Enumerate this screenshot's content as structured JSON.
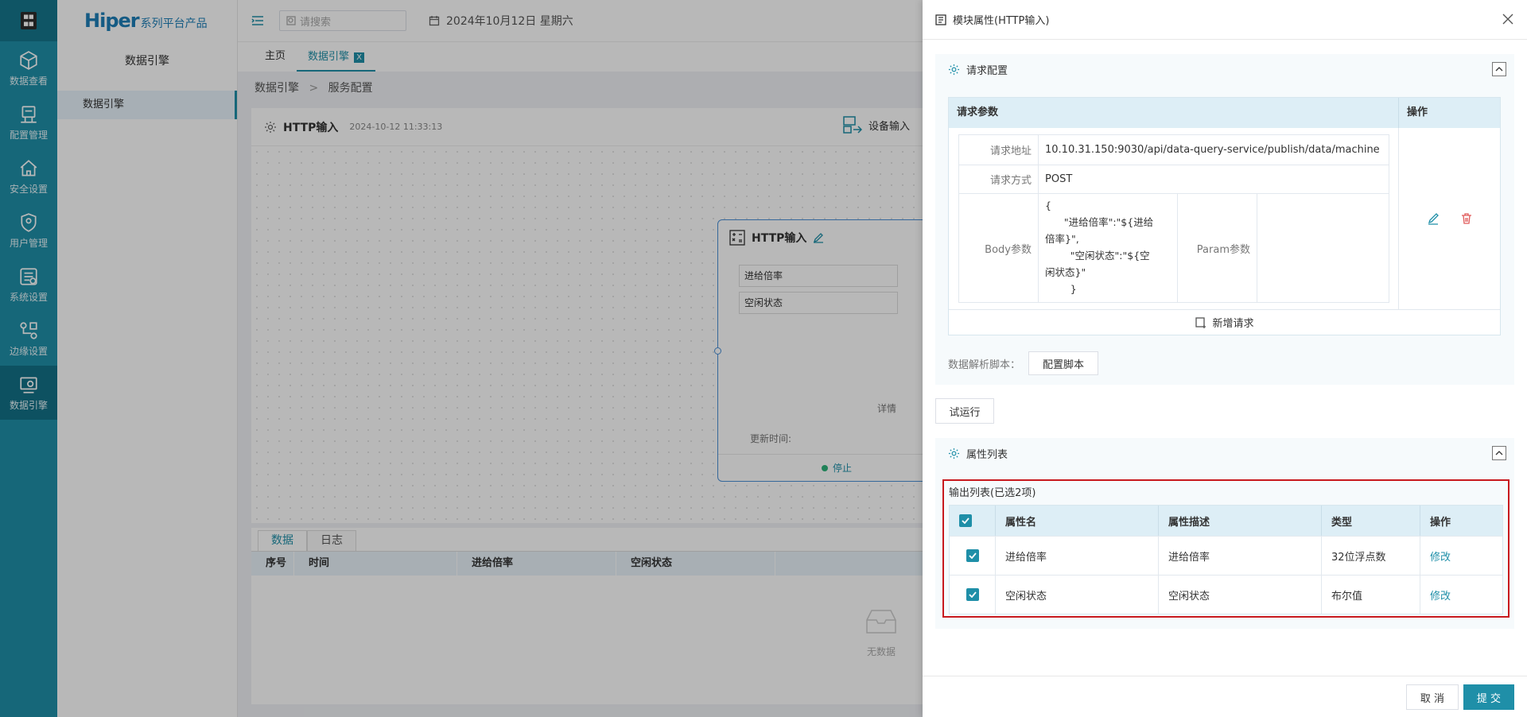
{
  "rail": {
    "items": [
      {
        "label": "数据查看",
        "icon": "cube-icon"
      },
      {
        "label": "配置管理",
        "icon": "config-icon"
      },
      {
        "label": "安全设置",
        "icon": "home-shield-icon"
      },
      {
        "label": "用户管理",
        "icon": "shield-user-icon"
      },
      {
        "label": "系统设置",
        "icon": "settings-icon"
      },
      {
        "label": "边缘设置",
        "icon": "edge-icon"
      },
      {
        "label": "数据引擎",
        "icon": "engine-icon"
      }
    ],
    "active": "数据引擎"
  },
  "sidebar": {
    "brand": "Hiper",
    "brand_sub": "系列平台产品",
    "title": "数据引擎",
    "item": "数据引擎"
  },
  "topbar": {
    "search_placeholder": "请搜索",
    "date": "2024年10月12日 星期六"
  },
  "tabs": [
    {
      "label": "主页"
    },
    {
      "label": "数据引擎",
      "close": "X"
    }
  ],
  "breadcrumb": {
    "level1": "数据引擎",
    "sep": ">",
    "level2": "服务配置"
  },
  "canvas": {
    "title": "HTTP输入",
    "time": "2024-10-12 11:33:13",
    "device_button": "设备输入",
    "node": {
      "title": "HTTP输入",
      "fields": [
        "进给倍率",
        "空闲状态"
      ],
      "detail": "详情",
      "update_label": "更新时间:",
      "status": "停止"
    }
  },
  "datapanel": {
    "tabs": [
      "数据",
      "日志"
    ],
    "columns": [
      "序号",
      "时间",
      "进给倍率",
      "空闲状态"
    ],
    "empty": "无数据"
  },
  "drawer": {
    "title": "模块属性(HTTP输入)",
    "request_section": {
      "title": "请求配置",
      "col_params": "请求参数",
      "col_ops": "操作",
      "url_label": "请求地址",
      "url": "10.10.31.150:9030/api/data-query-service/publish/data/machine",
      "method_label": "请求方式",
      "method": "POST",
      "body_label": "Body参数",
      "body": "{\n      \"进给倍率\":\"${进给\n倍率}\",\n        \"空闲状态\":\"${空\n闲状态}\"\n        }",
      "param_label": "Param参数",
      "add_request": "新增请求",
      "script_label": "数据解析脚本：",
      "script_button": "配置脚本"
    },
    "trial_button": "试运行",
    "property_section": {
      "title": "属性列表",
      "output_label": "输出列表(已选2项)",
      "columns": [
        "属性名",
        "属性描述",
        "类型",
        "操作"
      ],
      "rows": [
        {
          "name": "进给倍率",
          "desc": "进给倍率",
          "type": "32位浮点数",
          "op": "修改"
        },
        {
          "name": "空闲状态",
          "desc": "空闲状态",
          "type": "布尔值",
          "op": "修改"
        }
      ]
    },
    "footer": {
      "cancel": "取 消",
      "submit": "提 交"
    }
  },
  "colors": {
    "accent": "#1f8fa8",
    "highlight_border": "#c8191e",
    "node_border": "#4a8fd6"
  }
}
